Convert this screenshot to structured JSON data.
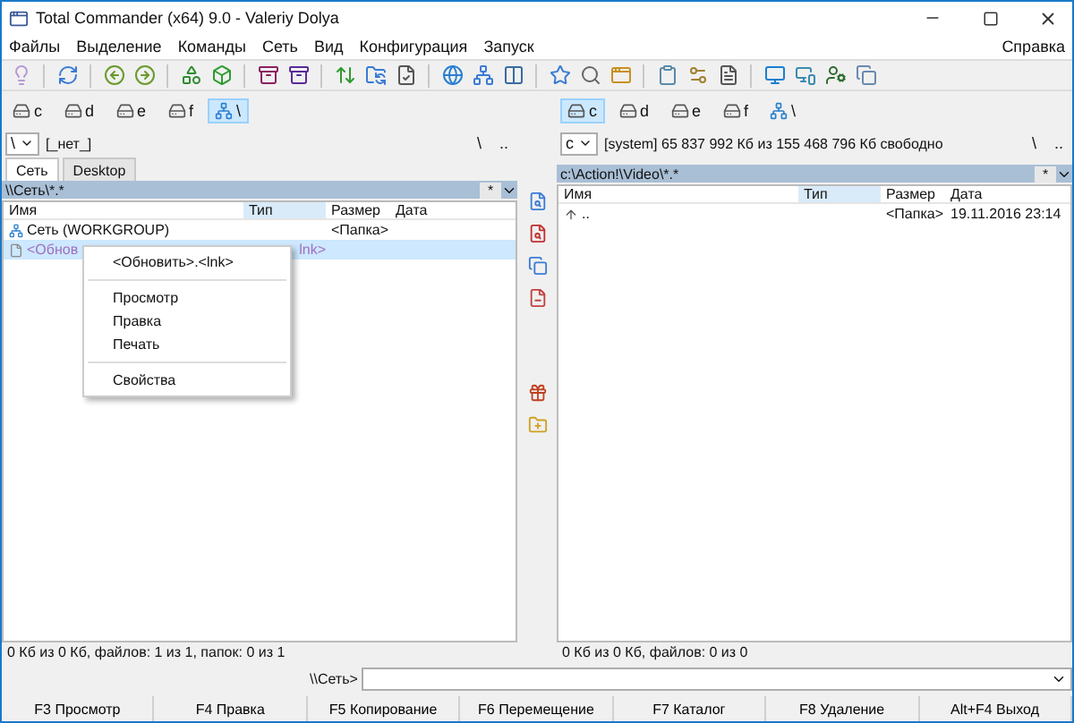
{
  "window": {
    "title": "Total Commander (x64) 9.0 - Valeriy Dolya"
  },
  "menu": {
    "items": [
      "Файлы",
      "Выделение",
      "Команды",
      "Сеть",
      "Вид",
      "Конфигурация",
      "Запуск"
    ],
    "help": "Справка"
  },
  "left_panel": {
    "drives": [
      {
        "label": "c",
        "selected": false
      },
      {
        "label": "d",
        "selected": false
      },
      {
        "label": "e",
        "selected": false
      },
      {
        "label": "f",
        "selected": false
      },
      {
        "label": "\\",
        "selected": true
      }
    ],
    "drive_select": "\\",
    "info": "[_нет_]",
    "root_button": "\\",
    "up_button": "..",
    "tabs": [
      {
        "label": "Сеть",
        "selected": true
      },
      {
        "label": "Desktop",
        "selected": false
      }
    ],
    "path": "\\\\Сеть\\*.*",
    "filter": "*",
    "columns": [
      {
        "label": "Имя",
        "sorted": false
      },
      {
        "label": "Тип",
        "sorted": true
      },
      {
        "label": "Размер",
        "sorted": false
      },
      {
        "label": "Дата",
        "sorted": false
      }
    ],
    "rows": [
      {
        "kind": "network",
        "name": "Сеть (WORKGROUP)",
        "size": "<Папка>",
        "selected": false
      },
      {
        "kind": "file",
        "name": "<Обнов",
        "type": "lnk>",
        "selected": true
      }
    ],
    "status": "0 Кб из 0 Кб, файлов: 1 из 1, папок: 0 из 1"
  },
  "right_panel": {
    "drives": [
      {
        "label": "c",
        "selected": true
      },
      {
        "label": "d",
        "selected": false
      },
      {
        "label": "e",
        "selected": false
      },
      {
        "label": "f",
        "selected": false
      },
      {
        "label": "\\",
        "selected": false
      }
    ],
    "drive_select": "c",
    "info": "[system]  65 837 992 Кб из 155 468 796 Кб свободно",
    "root_button": "\\",
    "up_button": "..",
    "path": "c:\\Action!\\Video\\*.*",
    "filter": "*",
    "columns": [
      {
        "label": "Имя",
        "sorted": false
      },
      {
        "label": "Тип",
        "sorted": true
      },
      {
        "label": "Размер",
        "sorted": false
      },
      {
        "label": "Дата",
        "sorted": false
      }
    ],
    "rows": [
      {
        "kind": "up",
        "name": "..",
        "size": "<Папка>",
        "date": "19.11.2016 23:14",
        "selected": false
      }
    ],
    "status": "0 Кб из 0 Кб, файлов: 0 из 0"
  },
  "context_menu": {
    "groups": [
      [
        "<Обновить>.<lnk>"
      ],
      [
        "Просмотр",
        "Правка",
        "Печать"
      ],
      [
        "Свойства"
      ]
    ]
  },
  "command_line": {
    "prompt": "\\\\Сеть>"
  },
  "function_keys": [
    "F3 Просмотр",
    "F4 Правка",
    "F5 Копирование",
    "F6 Перемещение",
    "F7 Каталог",
    "F8 Удаление",
    "Alt+F4 Выход"
  ]
}
